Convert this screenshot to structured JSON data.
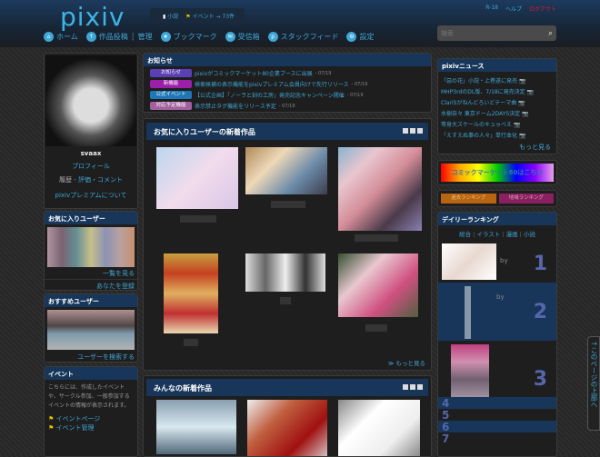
{
  "header": {
    "logo": "pixiv",
    "quick": [
      {
        "icon": "book-icon",
        "label": "小説"
      },
      {
        "icon": "flag-icon",
        "label": "イベント → 73件"
      }
    ],
    "toplinks": [
      "R-18",
      "ヘルプ",
      "ログアウト"
    ],
    "search_placeholder": "検索"
  },
  "nav": [
    {
      "icon": "home-icon",
      "label": "ホーム"
    },
    {
      "icon": "upload-icon",
      "label": "作品投稿"
    },
    {
      "icon": "",
      "label": "管理"
    },
    {
      "icon": "star-icon",
      "label": "ブックマーク"
    },
    {
      "icon": "mail-icon",
      "label": "受信箱"
    },
    {
      "icon": "feed-icon",
      "label": "スタックフィード"
    },
    {
      "icon": "gear-icon",
      "label": "設定"
    }
  ],
  "profile": {
    "name": "svaax",
    "profile_link": "プロフィール",
    "history": "履歴",
    "rating": " - 評価・コメント",
    "premium": "pixivプレミアムについて"
  },
  "fav_users": {
    "title": "お気に入りユーザー",
    "list_link": "一覧を見る",
    "register": "あなたを登録"
  },
  "recommended": {
    "title": "おすすめユーザー",
    "search_link": "ユーザーを検索する"
  },
  "event": {
    "title": "イベント",
    "text": "こちらには、作成したイベントや、サークル参加、一般参加するイベントの情報が表示されます。",
    "links": [
      "イベントページ",
      "イベント管理"
    ]
  },
  "notices": {
    "title": "お知らせ",
    "items": [
      {
        "badge": "お知らせ",
        "color": "#5b3fb5",
        "text": "pixivがコミックマーケット80企業ブースに出展",
        "date": "07/19"
      },
      {
        "badge": "新機能",
        "color": "#9b1fa8",
        "text": "検索候補の表示機能をpixivプレミアム会員向けで先行リリース",
        "date": "07/19"
      },
      {
        "badge": "公式イベント",
        "color": "#1d77b8",
        "text": "【公式企画】「ノーラと刻の工房」発売記念キャンペーン開催",
        "date": "07/19"
      },
      {
        "badge": "対応予定機能",
        "color": "#a2609e",
        "text": "表示禁止タグ機能をリリース予定",
        "date": "07/19"
      }
    ]
  },
  "fav_works": {
    "title": "お気に入りユーザーの新着作品",
    "more": "≫ もっと見る"
  },
  "all_works": {
    "title": "みんなの新着作品"
  },
  "news": {
    "title": "pixivニュース",
    "items": [
      "「惡の花」小説・上巻遂に発売",
      "MHP3rdのDL版、7/18に発売決定",
      "ClariSがねんどろいどテーマ曲",
      "水樹奈々 東京ドーム2DAYS決定",
      "等身大スケールのキュゥべえ",
      "「えすえぬ事の人々」単行本化"
    ],
    "more": "もっと見る"
  },
  "comiket_banner": "コミックマーケット80はこちら",
  "ranking_buttons": [
    "過去ランキング",
    "地域ランキング"
  ],
  "daily": {
    "title": "デイリーランキング",
    "tabs": [
      "総合",
      "イラスト",
      "漫画",
      "小説"
    ],
    "by": "by",
    "ranks": [
      "1",
      "2",
      "3",
      "4",
      "5",
      "6",
      "7"
    ]
  },
  "scroll_top": "↑このページの上部へ"
}
